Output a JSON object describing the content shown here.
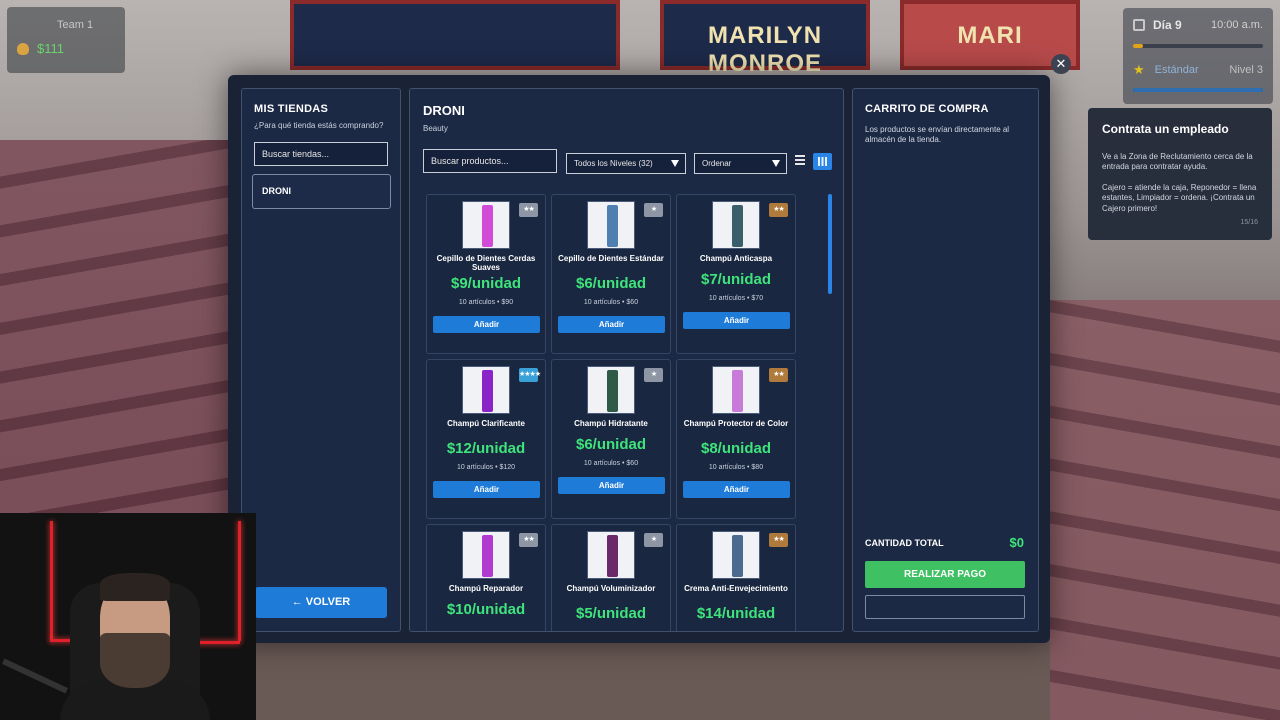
{
  "background": {
    "posters": [
      "",
      "MARILYN MONROE",
      "MARI"
    ]
  },
  "hud": {
    "team_label": "Team 1",
    "money": "$111",
    "day": "Día 9",
    "time": "10:00 a.m.",
    "rank": "Estándar",
    "level": "Nivel 3",
    "day_progress": 0.08,
    "xp_progress": 1.0
  },
  "tip": {
    "title": "Contrata un empleado",
    "line1": "Ve a la Zona de Reclutamiento cerca de la entrada para contratar ayuda.",
    "line2": "Cajero = atiende la caja, Reponedor = llena estantes, Limpiador = ordena. ¡Contrata un Cajero primero!",
    "counter": "15/16"
  },
  "stores": {
    "title": "MIS TIENDAS",
    "subtitle": "¿Para qué tienda estás comprando?",
    "search_placeholder": "Buscar tiendas...",
    "items": [
      {
        "label": "DRONI"
      }
    ],
    "back_label": "← VOLVER"
  },
  "shop": {
    "title": "DRONI",
    "category": "Beauty",
    "search_placeholder": "Buscar productos...",
    "level_filter": "Todos los Niveles (32)",
    "order_filter": "Ordenar",
    "add_label": "Añadir",
    "products": [
      {
        "name": "Cepillo de Dientes Cerdas Suaves",
        "price": "$9/unidad",
        "info": "10 artículos • $90",
        "stars": "★★",
        "badge_color": "#8e96a6",
        "color": "#d14ad8"
      },
      {
        "name": "Cepillo de Dientes Estándar",
        "price": "$6/unidad",
        "info": "10 artículos • $60",
        "stars": "★",
        "badge_color": "#8e96a6",
        "color": "#4f7fb0"
      },
      {
        "name": "Champú Anticaspa",
        "price": "$7/unidad",
        "info": "10 artículos • $70",
        "stars": "★★",
        "badge_color": "#b07a3c",
        "color": "#3a5f6a"
      },
      {
        "name": "Champú Clarificante",
        "price": "$12/unidad",
        "info": "10 artículos • $120",
        "stars": "★★★★",
        "badge_color": "#3aa0d8",
        "color": "#8a23c8"
      },
      {
        "name": "Champú Hidratante",
        "price": "$6/unidad",
        "info": "10 artículos • $60",
        "stars": "★",
        "badge_color": "#8e96a6",
        "color": "#2f5a48"
      },
      {
        "name": "Champú Protector de Color",
        "price": "$8/unidad",
        "info": "10 artículos • $80",
        "stars": "★★",
        "badge_color": "#b07a3c",
        "color": "#c77ad8"
      },
      {
        "name": "Champú Reparador",
        "price": "$10/unidad",
        "info": "",
        "stars": "★★",
        "badge_color": "#8e96a6",
        "color": "#b13ad0"
      },
      {
        "name": "Champú Voluminizador",
        "price": "$5/unidad",
        "info": "",
        "stars": "★",
        "badge_color": "#8e96a6",
        "color": "#6a2a6a"
      },
      {
        "name": "Crema Anti-Envejecimiento",
        "price": "$14/unidad",
        "info": "",
        "stars": "★★",
        "badge_color": "#b07a3c",
        "color": "#4a6a90"
      }
    ]
  },
  "cart": {
    "title": "CARRITO DE COMPRA",
    "note": "Los productos se envían directamente al almacén de la tienda.",
    "total_label": "CANTIDAD TOTAL",
    "total_value": "$0",
    "pay_label": "REALIZAR PAGO"
  },
  "colors": {
    "accent_blue": "#1f7bd8",
    "price_green": "#3ee47b",
    "pay_green": "#3fc163",
    "panel": "#1c2944"
  }
}
